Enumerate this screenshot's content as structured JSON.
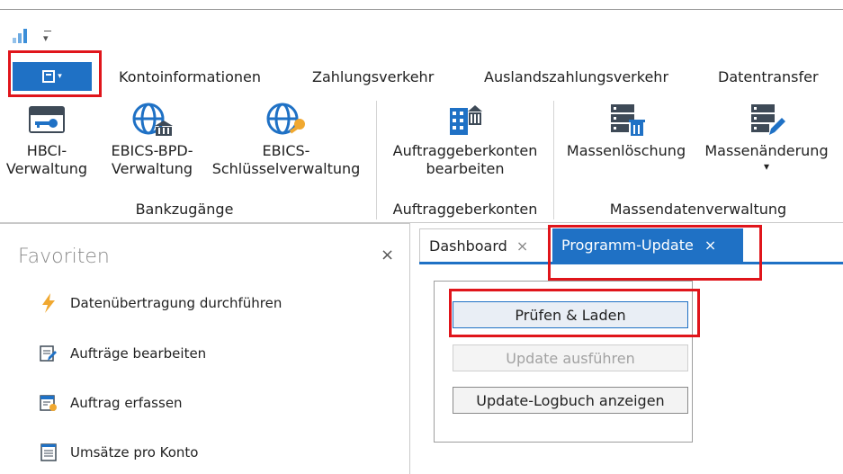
{
  "quick_access": {
    "app_icon": "bar-chart-icon",
    "customize_icon": "dropdown-arrow-icon"
  },
  "file_menu": {
    "icon": "menu-list-icon",
    "highlighted": true
  },
  "ribbon_tabs": [
    {
      "label": "Kontoinformationen"
    },
    {
      "label": "Zahlungsverkehr"
    },
    {
      "label": "Auslandszahlungsverkehr"
    },
    {
      "label": "Datentransfer"
    }
  ],
  "ribbon": {
    "groups": [
      {
        "label": "Bankzugänge",
        "buttons": [
          {
            "label1": "HBCI-",
            "label2": "Verwaltung",
            "icon": "card-key-icon"
          },
          {
            "label1": "EBICS-BPD-",
            "label2": "Verwaltung",
            "icon": "globe-bank-icon"
          },
          {
            "label1": "EBICS-",
            "label2": "Schlüsselverwaltung",
            "icon": "globe-key-icon"
          }
        ]
      },
      {
        "label": "Auftraggeberkonten",
        "buttons": [
          {
            "label1": "Auftraggeberkonten",
            "label2": "bearbeiten",
            "icon": "building-icon"
          }
        ]
      },
      {
        "label": "Massendatenverwaltung",
        "buttons": [
          {
            "label1": "Massenlöschung",
            "label2": "",
            "icon": "server-delete-icon"
          },
          {
            "label1": "Massenänderung",
            "label2": "▾",
            "icon": "server-edit-icon"
          }
        ]
      }
    ]
  },
  "favorites": {
    "title": "Favoriten",
    "close": "×",
    "items": [
      {
        "label": "Datenübertragung durchführen",
        "icon": "lightning-icon"
      },
      {
        "label": "Aufträge bearbeiten",
        "icon": "edit-document-icon"
      },
      {
        "label": "Auftrag erfassen",
        "icon": "new-document-icon"
      },
      {
        "label": "Umsätze pro Konto",
        "icon": "list-document-icon"
      }
    ]
  },
  "document_tabs": [
    {
      "label": "Dashboard",
      "close": "×",
      "active": false
    },
    {
      "label": "Programm-Update",
      "close": "×",
      "active": true
    }
  ],
  "update_panel": {
    "check_button": "Prüfen & Laden",
    "run_button": "Update ausführen",
    "log_button": "Update-Logbuch anzeigen"
  },
  "colors": {
    "accent": "#1f71c5",
    "highlight": "#e0151b"
  }
}
